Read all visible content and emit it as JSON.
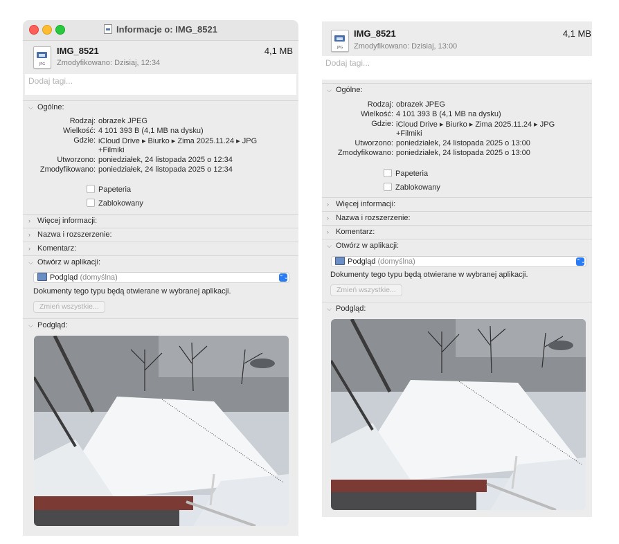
{
  "left": {
    "window_title": "Informacje o: IMG_8521",
    "file_name": "IMG_8521",
    "file_size": "4,1 MB",
    "modified": "Zmodyfikowano: Dzisiaj, 12:34",
    "tags_placeholder": "Dodaj tagi...",
    "general": {
      "header": "Ogólne:",
      "kind_label": "Rodzaj:",
      "kind": "obrazek JPEG",
      "size_label": "Wielkość:",
      "size": "4 101 393 B (4,1 MB na dysku)",
      "where_label": "Gdzie:",
      "where_line1": "iCloud Drive ▸ Biurko ▸ Zima 2025.11.24 ▸ JPG",
      "where_line2": "+Filmiki",
      "created_label": "Utworzono:",
      "created": "poniedziałek, 24 listopada 2025 o 12:34",
      "modified_label": "Zmodyfikowano:",
      "modified": "poniedziałek, 24 listopada 2025 o 12:34",
      "stationery": "Papeteria",
      "locked": "Zablokowany"
    },
    "more_info": "Więcej informacji:",
    "name_ext": "Nazwa i rozszerzenie:",
    "comments": "Komentarz:",
    "open_with": {
      "header": "Otwórz w aplikacji:",
      "app": "Podgląd",
      "app_default": "(domyślna)",
      "note": "Dokumenty tego typu będą otwierane w wybranej aplikacji.",
      "change_all": "Zmień wszystkie..."
    },
    "preview_header": "Podgląd:"
  },
  "right": {
    "file_name": "IMG_8521",
    "file_size": "4,1 MB",
    "modified": "Zmodyfikowano: Dzisiaj, 13:00",
    "tags_placeholder": "Dodaj tagi...",
    "general": {
      "header": "Ogólne:",
      "kind_label": "Rodzaj:",
      "kind": "obrazek JPEG",
      "size_label": "Wielkość:",
      "size": "4 101 393 B (4,1 MB na dysku)",
      "where_label": "Gdzie:",
      "where_line1": "iCloud Drive ▸ Biurko ▸ Zima 2025.11.24 ▸ JPG",
      "where_line2": "+Filmiki",
      "created_label": "Utworzono:",
      "created": "poniedziałek, 24 listopada 2025 o 13:00",
      "modified_label": "Zmodyfikowano:",
      "modified": "poniedziałek, 24 listopada 2025 o 13:00",
      "stationery": "Papeteria",
      "locked": "Zablokowany"
    },
    "more_info": "Więcej informacji:",
    "name_ext": "Nazwa i rozszerzenie:",
    "comments": "Komentarz:",
    "open_with": {
      "header": "Otwórz w aplikacji:",
      "app": "Podgląd",
      "app_default": "(domyślna)",
      "note": "Dokumenty tego typu będą otwierane w wybranej aplikacji.",
      "change_all": "Zmień wszystkie..."
    },
    "preview_header": "Podgląd:"
  },
  "icons": {
    "file_icon_ext": "JPG",
    "chevron_open": "⌵",
    "chevron_closed": "›",
    "select_arrows": "⌃⌄"
  },
  "colors": {
    "accent": "#2a7cf6",
    "close": "#fe5f57",
    "minimize": "#febc2e",
    "zoom": "#28c840"
  }
}
